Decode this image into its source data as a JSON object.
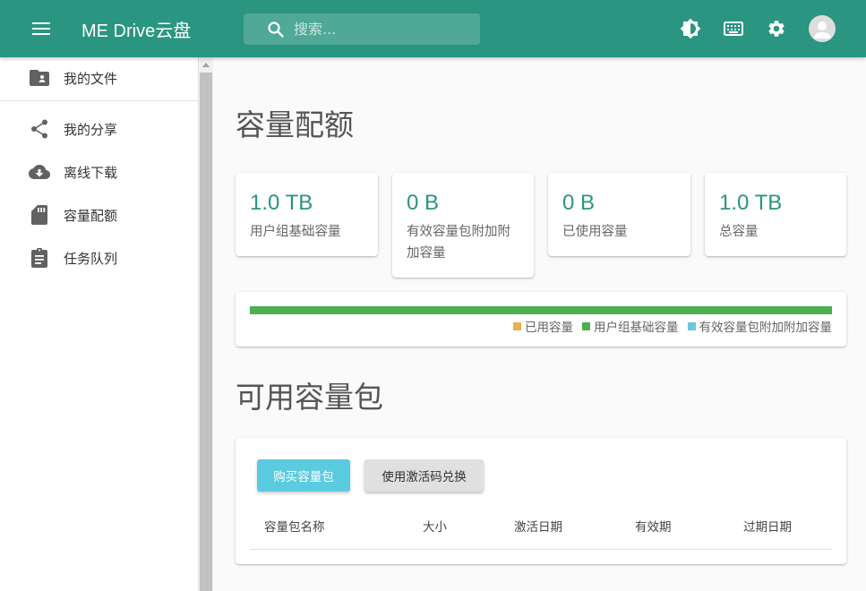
{
  "appbar": {
    "title": "ME Drive云盘",
    "search_placeholder": "搜索...",
    "bg_color": "#2a9580"
  },
  "sidebar": {
    "items": [
      {
        "label": "我的文件",
        "icon": "folder-user-icon"
      },
      {
        "label": "我的分享",
        "icon": "share-icon"
      },
      {
        "label": "离线下载",
        "icon": "cloud-download-icon"
      },
      {
        "label": "容量配额",
        "icon": "sd-card-icon"
      },
      {
        "label": "任务队列",
        "icon": "clipboard-icon"
      }
    ]
  },
  "quota": {
    "heading": "容量配额",
    "stats": [
      {
        "value": "1.0 TB",
        "label": "用户组基础容量"
      },
      {
        "value": "0 B",
        "label": "有效容量包附加附加容量"
      },
      {
        "value": "0 B",
        "label": "已使用容量"
      },
      {
        "value": "1.0 TB",
        "label": "总容量"
      }
    ],
    "legend": [
      {
        "label": "已用容量",
        "color": "#e8b04f"
      },
      {
        "label": "用户组基础容量",
        "color": "#4caf50"
      },
      {
        "label": "有效容量包附加附加容量",
        "color": "#6ec6e0"
      }
    ],
    "bar_fraction": 1.0
  },
  "packs": {
    "heading": "可用容量包",
    "buy_label": "购买容量包",
    "redeem_label": "使用激活码兑换",
    "columns": [
      "容量包名称",
      "大小",
      "激活日期",
      "有效期",
      "过期日期"
    ]
  }
}
